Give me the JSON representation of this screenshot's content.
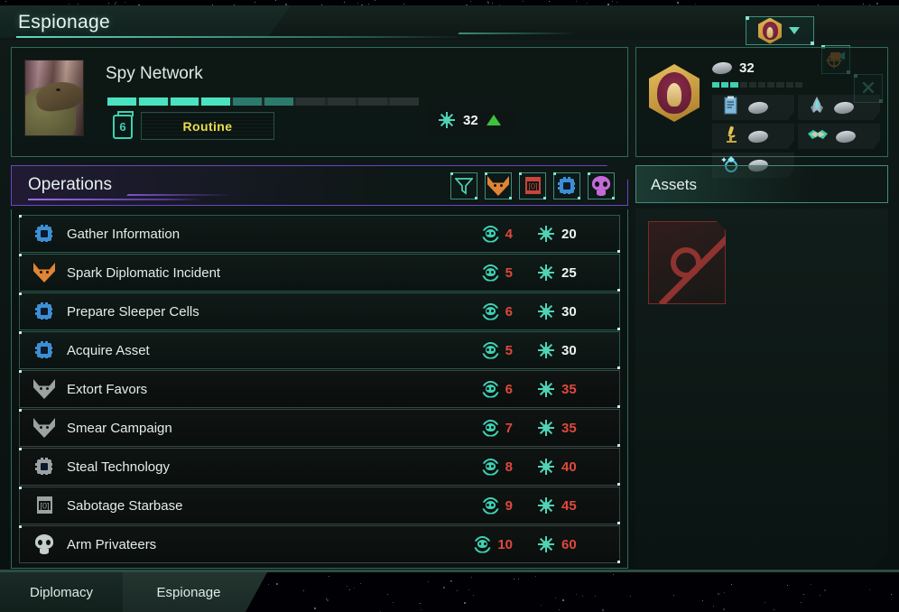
{
  "window": {
    "title": "Espionage",
    "controls": {
      "empire_select": "empire-emblem-dropdown",
      "camera": "camera-target-icon",
      "close": "✕"
    }
  },
  "spy_network": {
    "title": "Spy Network",
    "status": "Routine",
    "level_icon": "6",
    "progress_segments_filled": 4,
    "progress_segments_dim": 2,
    "progress_segments_total": 10,
    "espionage_value": "32",
    "trend": "up"
  },
  "intel": {
    "value": "32",
    "bar_filled": 3,
    "bar_total": 10,
    "categories": [
      {
        "name": "military-intel",
        "icon": "ship-icon"
      },
      {
        "name": "government-intel",
        "icon": "clipboard-icon"
      },
      {
        "name": "science-intel",
        "icon": "microscope-icon"
      },
      {
        "name": "diplomacy-intel",
        "icon": "handshake-icon"
      },
      {
        "name": "artifact-intel",
        "icon": "ring-icon"
      }
    ]
  },
  "operations": {
    "title": "Operations",
    "filters": [
      {
        "name": "filter-all",
        "icon": "funnel-icon",
        "color": "#4fd3b4"
      },
      {
        "name": "filter-subterfuge",
        "icon": "fox-icon",
        "color": "#e08435"
      },
      {
        "name": "filter-sabotage",
        "icon": "barrel-icon",
        "color": "#c8453c"
      },
      {
        "name": "filter-technology",
        "icon": "chip-icon",
        "color": "#3d8fd4"
      },
      {
        "name": "filter-provocation",
        "icon": "skull-icon",
        "color": "#c46ad8"
      }
    ],
    "columns": {
      "difficulty": "difficulty",
      "cost": "espionage-cost"
    },
    "rows": [
      {
        "name": "Gather Information",
        "icon": "chip-icon",
        "icon_color": "#3d8fd4",
        "difficulty": "4",
        "cost": "20",
        "available": true,
        "cost_affordable": true
      },
      {
        "name": "Spark Diplomatic Incident",
        "icon": "fox-icon",
        "icon_color": "#e08435",
        "difficulty": "5",
        "cost": "25",
        "available": true,
        "cost_affordable": true
      },
      {
        "name": "Prepare Sleeper Cells",
        "icon": "chip-icon",
        "icon_color": "#3d8fd4",
        "difficulty": "6",
        "cost": "30",
        "available": true,
        "cost_affordable": true
      },
      {
        "name": "Acquire Asset",
        "icon": "chip-icon",
        "icon_color": "#3d8fd4",
        "difficulty": "5",
        "cost": "30",
        "available": true,
        "cost_affordable": true
      },
      {
        "name": "Extort Favors",
        "icon": "fox-icon",
        "icon_color": "#9aa3a1",
        "difficulty": "6",
        "cost": "35",
        "available": false,
        "cost_affordable": false
      },
      {
        "name": "Smear Campaign",
        "icon": "fox-icon",
        "icon_color": "#9aa3a1",
        "difficulty": "7",
        "cost": "35",
        "available": false,
        "cost_affordable": false
      },
      {
        "name": "Steal Technology",
        "icon": "chip-icon",
        "icon_color": "#9aa3a1",
        "difficulty": "8",
        "cost": "40",
        "available": false,
        "cost_affordable": false
      },
      {
        "name": "Sabotage Starbase",
        "icon": "barrel-icon",
        "icon_color": "#9aa3a1",
        "difficulty": "9",
        "cost": "45",
        "available": false,
        "cost_affordable": false
      },
      {
        "name": "Arm Privateers",
        "icon": "skull-icon",
        "icon_color": "#c6cecb",
        "difficulty": "10",
        "cost": "60",
        "available": false,
        "cost_affordable": false
      }
    ]
  },
  "assets": {
    "title": "Assets",
    "empty_slot": "no-asset-slot"
  },
  "tabs": [
    {
      "label": "Diplomacy",
      "active": false
    },
    {
      "label": "Espionage",
      "active": true
    }
  ],
  "colors": {
    "accent_teal": "#3fd0b2",
    "accent_purple": "#6b46c4",
    "value_red": "#e0483c",
    "status_yellow": "#e8de4a",
    "trend_green": "#3ec23e"
  }
}
